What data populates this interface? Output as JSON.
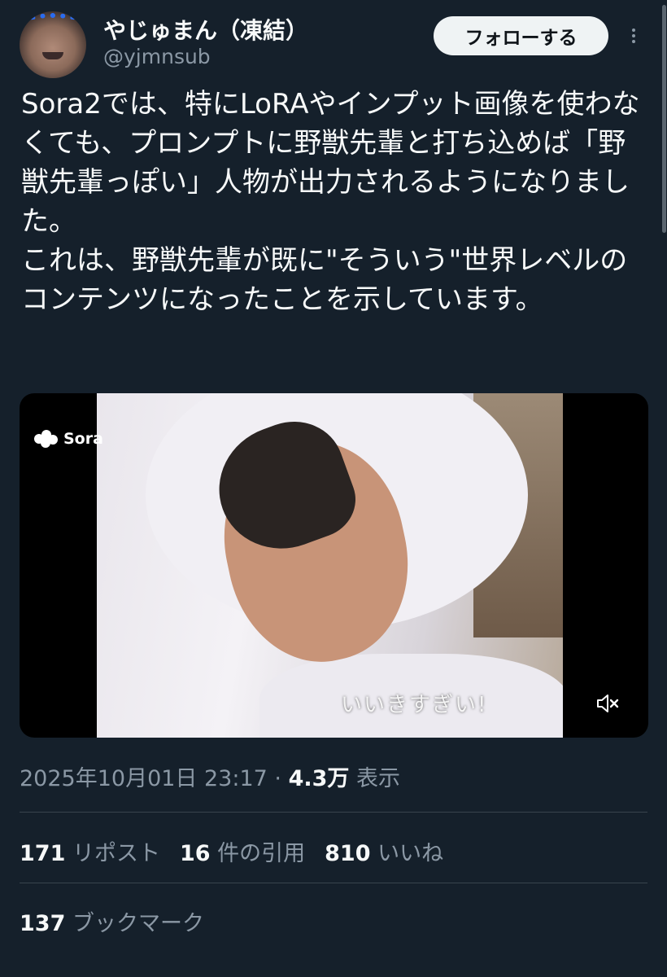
{
  "author": {
    "display_name": "やじゅまん（凍結）",
    "handle": "@yjmnsub",
    "avatar_icon": "avatar-face-icon"
  },
  "follow_button_label": "フォローする",
  "more_icon": "more-vertical-icon",
  "tweet_text": "Sora2では、特にLoRAやインプット画像を使わなくても、プロンプトに野獣先輩と打ち込めば「野獣先輩っぽい」人物が出力されるようになりました。\nこれは、野獣先輩が既に\"そういう\"世界レベルのコンテンツになったことを示しています。",
  "media": {
    "watermark_label": "Sora",
    "subtitle_text": "いいきすぎい!",
    "mute_icon": "speaker-muted-icon"
  },
  "meta": {
    "date": "2025年10月01日 23:17",
    "separator": " · ",
    "views_count": "4.3万",
    "views_label": "表示"
  },
  "stats": {
    "reposts_count": "171",
    "reposts_label": "リポスト",
    "quotes_count": "16",
    "quotes_label": "件の引用",
    "likes_count": "810",
    "likes_label": "いいね",
    "bookmarks_count": "137",
    "bookmarks_label": "ブックマーク"
  },
  "colors": {
    "background": "#15202b",
    "text_primary": "#f7f9f9",
    "text_secondary": "#8b98a5",
    "divider": "#38444d",
    "button_bg": "#eff3f4"
  }
}
